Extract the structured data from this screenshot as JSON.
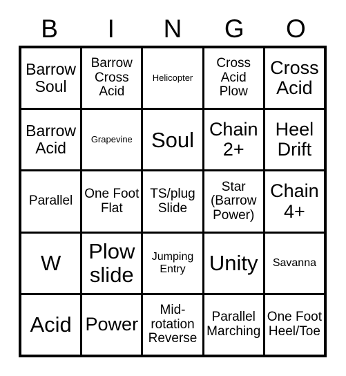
{
  "card": {
    "headers": [
      "B",
      "I",
      "N",
      "G",
      "O"
    ],
    "rows": [
      [
        {
          "text": "Barrow Soul",
          "size": "fs-lg"
        },
        {
          "text": "Barrow Cross Acid",
          "size": "fs-md"
        },
        {
          "text": "Helicopter",
          "size": "fs-xs"
        },
        {
          "text": "Cross Acid Plow",
          "size": "fs-md"
        },
        {
          "text": "Cross Acid",
          "size": "fs-xl"
        }
      ],
      [
        {
          "text": "Barrow Acid",
          "size": "fs-lg"
        },
        {
          "text": "Grapevine",
          "size": "fs-xs"
        },
        {
          "text": "Soul",
          "size": "fs-xxl"
        },
        {
          "text": "Chain 2+",
          "size": "fs-xl"
        },
        {
          "text": "Heel Drift",
          "size": "fs-xl"
        }
      ],
      [
        {
          "text": "Parallel",
          "size": "fs-md"
        },
        {
          "text": "One Foot Flat",
          "size": "fs-md"
        },
        {
          "text": "TS/plug Slide",
          "size": "fs-md"
        },
        {
          "text": "Star (Barrow Power)",
          "size": "fs-md"
        },
        {
          "text": "Chain 4+",
          "size": "fs-xl"
        }
      ],
      [
        {
          "text": "W",
          "size": "fs-xxl"
        },
        {
          "text": "Plow slide",
          "size": "fs-xxl"
        },
        {
          "text": "Jumping Entry",
          "size": "fs-sm"
        },
        {
          "text": "Unity",
          "size": "fs-xxl"
        },
        {
          "text": "Savanna",
          "size": "fs-sm"
        }
      ],
      [
        {
          "text": "Acid",
          "size": "fs-xxl"
        },
        {
          "text": "Power",
          "size": "fs-xl"
        },
        {
          "text": "Mid-rotation Reverse",
          "size": "fs-md"
        },
        {
          "text": "Parallel Marching",
          "size": "fs-md"
        },
        {
          "text": "One Foot Heel/Toe",
          "size": "fs-md"
        }
      ]
    ]
  },
  "colors": {
    "background": "#ffffff",
    "text": "#000000",
    "border": "#000000"
  }
}
